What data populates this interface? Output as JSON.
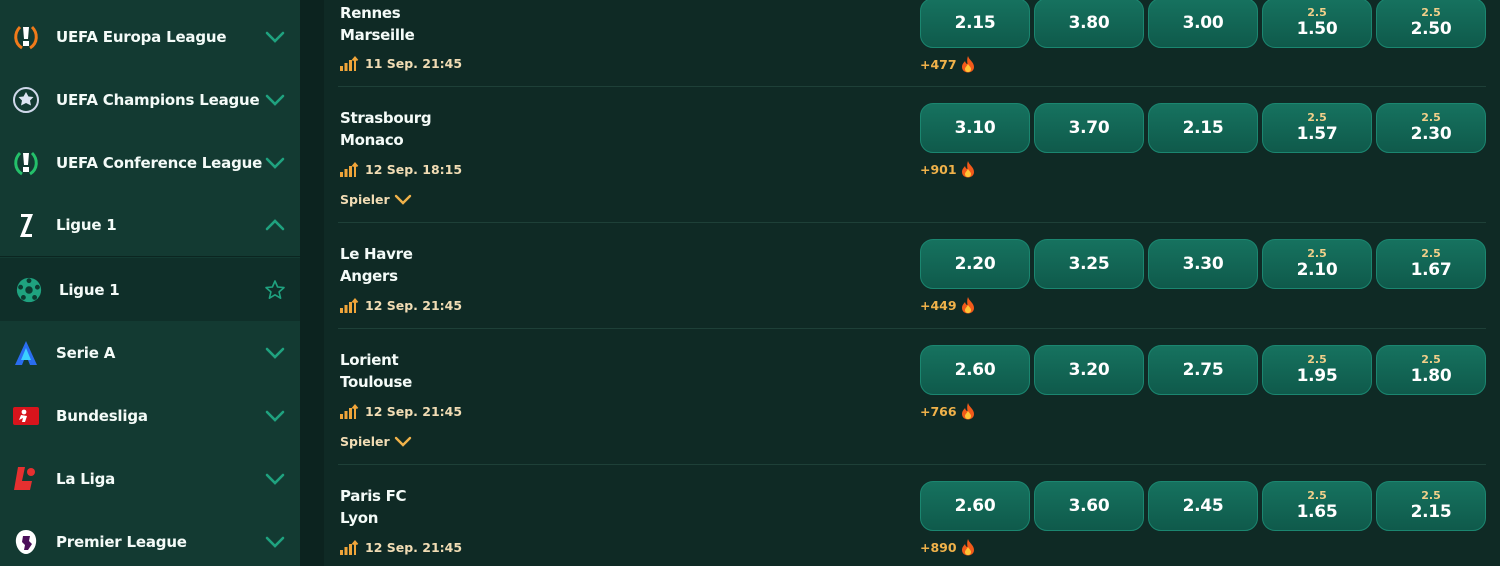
{
  "sidebar": {
    "items": [
      {
        "label": "UEFA Europa League",
        "icon": "europa-league-trophy-icon",
        "state": "collapsed"
      },
      {
        "label": "UEFA Champions League",
        "icon": "champions-league-ball-icon",
        "state": "collapsed"
      },
      {
        "label": "UEFA Conference League",
        "icon": "conference-league-trophy-icon",
        "state": "collapsed"
      },
      {
        "label": "Ligue 1",
        "icon": "ligue1-logo-icon",
        "state": "expanded"
      },
      {
        "label": "Ligue 1",
        "icon": "soccer-ball-icon",
        "state": "sub-item"
      },
      {
        "label": "Serie A",
        "icon": "serie-a-logo-icon",
        "state": "collapsed"
      },
      {
        "label": "Bundesliga",
        "icon": "bundesliga-logo-icon",
        "state": "collapsed"
      },
      {
        "label": "La Liga",
        "icon": "la-liga-logo-icon",
        "state": "collapsed"
      },
      {
        "label": "Premier League",
        "icon": "premier-league-lion-icon",
        "state": "collapsed"
      }
    ],
    "colors": {
      "accent": "#1fa27f",
      "background": "#133a32"
    }
  },
  "matches": [
    {
      "home": "Rennes",
      "away": "Marseille",
      "time": "11 Sep. 21:45",
      "more": "+477",
      "spieler": null,
      "odds": [
        {
          "value": "2.15"
        },
        {
          "value": "3.80"
        },
        {
          "value": "3.00"
        },
        {
          "line": "2.5",
          "value": "1.50"
        },
        {
          "line": "2.5",
          "value": "2.50"
        }
      ]
    },
    {
      "home": "Strasbourg",
      "away": "Monaco",
      "time": "12 Sep. 18:15",
      "more": "+901",
      "spieler": "Spieler",
      "odds": [
        {
          "value": "3.10"
        },
        {
          "value": "3.70"
        },
        {
          "value": "2.15"
        },
        {
          "line": "2.5",
          "value": "1.57"
        },
        {
          "line": "2.5",
          "value": "2.30"
        }
      ]
    },
    {
      "home": "Le Havre",
      "away": "Angers",
      "time": "12 Sep. 21:45",
      "more": "+449",
      "spieler": null,
      "odds": [
        {
          "value": "2.20"
        },
        {
          "value": "3.25"
        },
        {
          "value": "3.30"
        },
        {
          "line": "2.5",
          "value": "2.10"
        },
        {
          "line": "2.5",
          "value": "1.67"
        }
      ]
    },
    {
      "home": "Lorient",
      "away": "Toulouse",
      "time": "12 Sep. 21:45",
      "more": "+766",
      "spieler": "Spieler",
      "odds": [
        {
          "value": "2.60"
        },
        {
          "value": "3.20"
        },
        {
          "value": "2.75"
        },
        {
          "line": "2.5",
          "value": "1.95"
        },
        {
          "line": "2.5",
          "value": "1.80"
        }
      ]
    },
    {
      "home": "Paris FC",
      "away": "Lyon",
      "time": "12 Sep. 21:45",
      "more": "+890",
      "spieler": null,
      "odds": [
        {
          "value": "2.60"
        },
        {
          "value": "3.60"
        },
        {
          "value": "2.45"
        },
        {
          "line": "2.5",
          "value": "1.65"
        },
        {
          "line": "2.5",
          "value": "2.15"
        }
      ]
    }
  ],
  "icons": {
    "popularity": "signal-bars-icon",
    "hot": "fire-icon",
    "expand": "chevron-down-icon",
    "favorite": "star-outline-icon"
  }
}
